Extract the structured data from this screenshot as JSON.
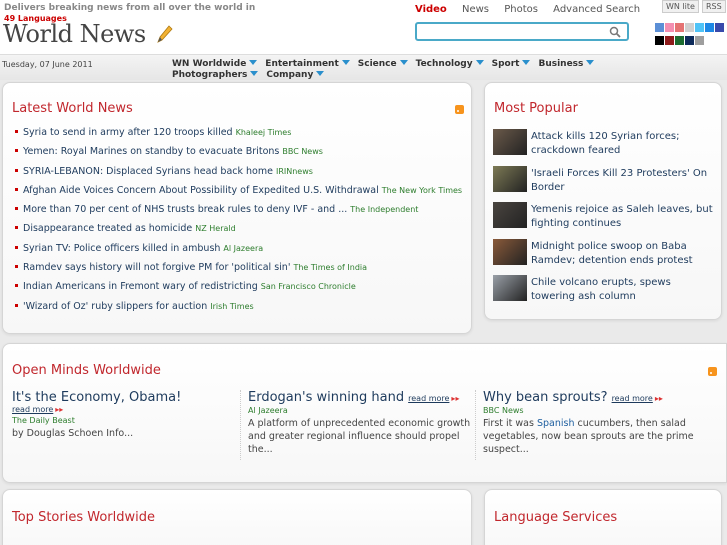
{
  "header": {
    "tagline": "Delivers breaking news from all over the world in",
    "languages": "49 Languages",
    "logo": "World News",
    "top_nav": [
      "Video",
      "News",
      "Photos",
      "Advanced Search"
    ],
    "search_placeholder": "",
    "wn_lite": "WN lite",
    "rss": "RSS",
    "theme_colors": [
      "#5b8fd6",
      "#f48fb1",
      "#e57373",
      "#d0d0d0",
      "#4fc3f7",
      "#1e88e5",
      "#3949ab",
      "#000000",
      "#8e1b1b",
      "#1b6b2f",
      "#0d2a5a",
      "#9e9e9e"
    ]
  },
  "datebar": {
    "date": "Tuesday, 07 June 2011",
    "nav": [
      "WN Worldwide",
      "Entertainment",
      "Science",
      "Technology",
      "Sport",
      "Business",
      "Photographers",
      "Company"
    ]
  },
  "latest": {
    "title": "Latest World News",
    "items": [
      {
        "text": "Syria to send in army after 120 troops killed",
        "source": "Khaleej Times"
      },
      {
        "text": "Yemen: Royal Marines on standby to evacuate Britons",
        "source": "BBC News"
      },
      {
        "text": "SYRIA-LEBANON: Displaced Syrians head back home",
        "source": "IRINnews"
      },
      {
        "text": "Afghan Aide Voices Concern About Possibility of Expedited U.S. Withdrawal",
        "source": "The New York Times"
      },
      {
        "text": "More than 70 per cent of NHS trusts break rules to deny IVF - and ...",
        "source": "The Independent"
      },
      {
        "text": "Disappearance treated as homicide",
        "source": "NZ Herald"
      },
      {
        "text": "Syrian TV: Police officers killed in ambush",
        "source": "Al Jazeera"
      },
      {
        "text": "Ramdev says history will not forgive PM for 'political sin'",
        "source": "The Times of India"
      },
      {
        "text": "Indian Americans in Fremont wary of redistricting",
        "source": "San Francisco Chronicle"
      },
      {
        "text": "'Wizard of Oz' ruby slippers for auction",
        "source": "Irish Times"
      }
    ]
  },
  "popular": {
    "title": "Most Popular",
    "items": [
      {
        "text": "Attack kills 120 Syrian forces; crackdown feared",
        "thumb": "#6b5a4a"
      },
      {
        "text": "'Israeli Forces Kill 23 Protesters' On Border",
        "thumb": "#7d7a55"
      },
      {
        "text": "Yemenis rejoice as Saleh leaves, but fighting continues",
        "thumb": "#4a4540"
      },
      {
        "text": "Midnight police swoop on Baba Ramdev; detention ends protest",
        "thumb": "#8a5a3a"
      },
      {
        "text": "Chile volcano erupts, spews towering ash column",
        "thumb": "#9aa0a8"
      }
    ]
  },
  "openminds": {
    "title": "Open Minds Worldwide",
    "more": "read more",
    "items": [
      {
        "title": "It's the Economy, Obama!",
        "source": "The Daily Beast",
        "desc": "by Douglas Schoen Info..."
      },
      {
        "title": "Erdogan's winning hand",
        "source": "Al Jazeera",
        "desc": "A platform of unprecedented economic growth and greater regional influence should propel the..."
      },
      {
        "title": "Why bean sprouts?",
        "source": "BBC News",
        "desc_pre": "First it was ",
        "desc_hl": "Spanish",
        "desc_post": " cucumbers, then salad vegetables, now bean sprouts are the prime suspect..."
      }
    ]
  },
  "topstories": {
    "title": "Top Stories Worldwide"
  },
  "langservices": {
    "title": "Language Services"
  }
}
